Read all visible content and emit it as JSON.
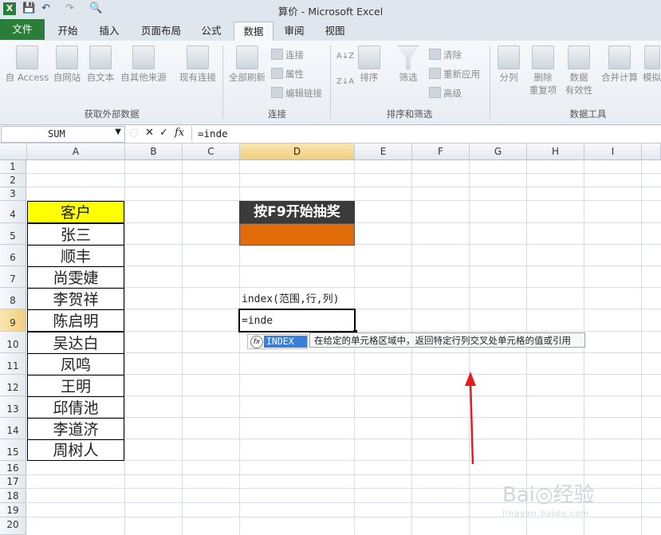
{
  "window": {
    "title_doc": "算价",
    "title_sep": " - ",
    "title_app": "Microsoft Excel"
  },
  "qat": {
    "save": "💾",
    "undo": "↶",
    "redo": "↷",
    "preview": "🔍"
  },
  "tabs": [
    {
      "label": "文件"
    },
    {
      "label": "开始"
    },
    {
      "label": "插入"
    },
    {
      "label": "页面布局"
    },
    {
      "label": "公式"
    },
    {
      "label": "数据"
    },
    {
      "label": "审阅"
    },
    {
      "label": "视图"
    }
  ],
  "ribbon": {
    "external": {
      "items": [
        "自 Access",
        "自网站",
        "自文本",
        "自其他来源",
        "现有连接"
      ],
      "group_label": "获取外部数据"
    },
    "connections": {
      "refresh": "全部刷新",
      "small": [
        "连接",
        "属性",
        "编辑链接"
      ],
      "group_label": "连接"
    },
    "sort_filter": {
      "sort": "排序",
      "filter": "筛选",
      "small": [
        "清除",
        "重新应用",
        "高级"
      ],
      "group_label": "排序和筛选"
    },
    "data_tools": {
      "split": "分列",
      "remove_dup_1": "删除",
      "remove_dup_2": "重复项",
      "validation_1": "数据",
      "validation_2": "有效性",
      "consolidate": "合并计算",
      "whatif": "模拟",
      "group_label": "数据工具"
    }
  },
  "formula_bar": {
    "name_box": "SUM",
    "cancel": "✕",
    "enter": "✓",
    "fx": "fx",
    "formula": "=inde"
  },
  "grid": {
    "columns": [
      "A",
      "B",
      "C",
      "D",
      "E",
      "F",
      "G",
      "H",
      "I"
    ],
    "rows": [
      "1",
      "2",
      "3",
      "4",
      "5",
      "6",
      "7",
      "8",
      "9",
      "10",
      "11",
      "12",
      "13",
      "14",
      "15",
      "16",
      "17",
      "18",
      "19",
      "20"
    ],
    "customers_header": "客户",
    "customers": [
      "张三",
      "顺丰",
      "尚雯婕",
      "李贺祥",
      "陈启明",
      "吴达白",
      "凤鸣",
      "王明",
      "邱倩池",
      "李道济",
      "周树人"
    ],
    "d4_label": "按F9开始抽奖",
    "d8_text": "index(范围,行,列)",
    "d9_text": "=inde"
  },
  "autocomplete": {
    "item": "INDEX",
    "tooltip": "在给定的单元格区域中，返回特定行列交叉处单元格的值或引用"
  },
  "watermark": {
    "brand": "Bai◎经验",
    "url": "jingyan.baidu.com"
  },
  "colors": {
    "file_tab": "#2a7e3a",
    "header_yellow": "#ffff00",
    "button_dark": "#3a3a3a",
    "button_orange": "#e36c0a",
    "arrow_red": "#e02020",
    "selected_header": "#f3cf7c"
  }
}
